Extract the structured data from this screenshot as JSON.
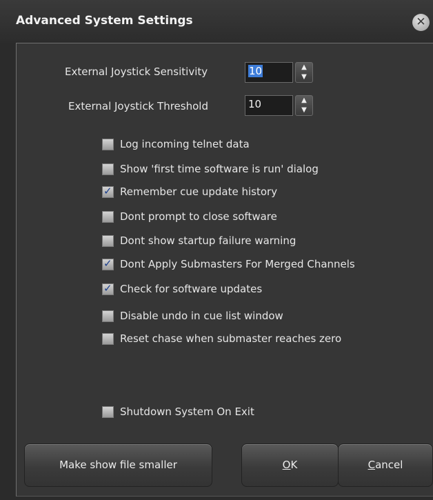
{
  "window": {
    "title": "Advanced System Settings",
    "close_glyph": "✕",
    "close_icon": "close-icon"
  },
  "spinners": [
    {
      "label": "External Joystick Sensitivity",
      "value": "10",
      "selected": true
    },
    {
      "label": "External Joystick Threshold",
      "value": "10",
      "selected": false
    }
  ],
  "spin_glyphs": {
    "up": "▲",
    "down": "▼"
  },
  "checkboxes": [
    {
      "label": "Log incoming telnet data",
      "checked": false
    },
    {
      "label": "Show 'first time software is run' dialog",
      "checked": false
    },
    {
      "label": "Remember cue update history",
      "checked": true
    },
    {
      "label": "Dont prompt to close software",
      "checked": false
    },
    {
      "label": "Dont show startup failure warning",
      "checked": false
    },
    {
      "label": "Dont Apply Submasters For Merged Channels",
      "checked": true
    },
    {
      "label": "Check for software updates",
      "checked": true
    },
    {
      "label": "Disable undo in cue list window",
      "checked": false
    },
    {
      "label": "Reset chase when submaster reaches zero",
      "checked": false
    },
    {
      "label": "Shutdown System On Exit",
      "checked": false
    }
  ],
  "check_glyph": "✓",
  "buttons": {
    "shrink": "Make show file smaller",
    "ok_mnemonic": "O",
    "ok_rest": "K",
    "cancel_mnemonic": "C",
    "cancel_rest": "ancel"
  },
  "colors": {
    "background": "#363636",
    "selection": "#3d7cd8",
    "check": "#1c3f8c"
  }
}
